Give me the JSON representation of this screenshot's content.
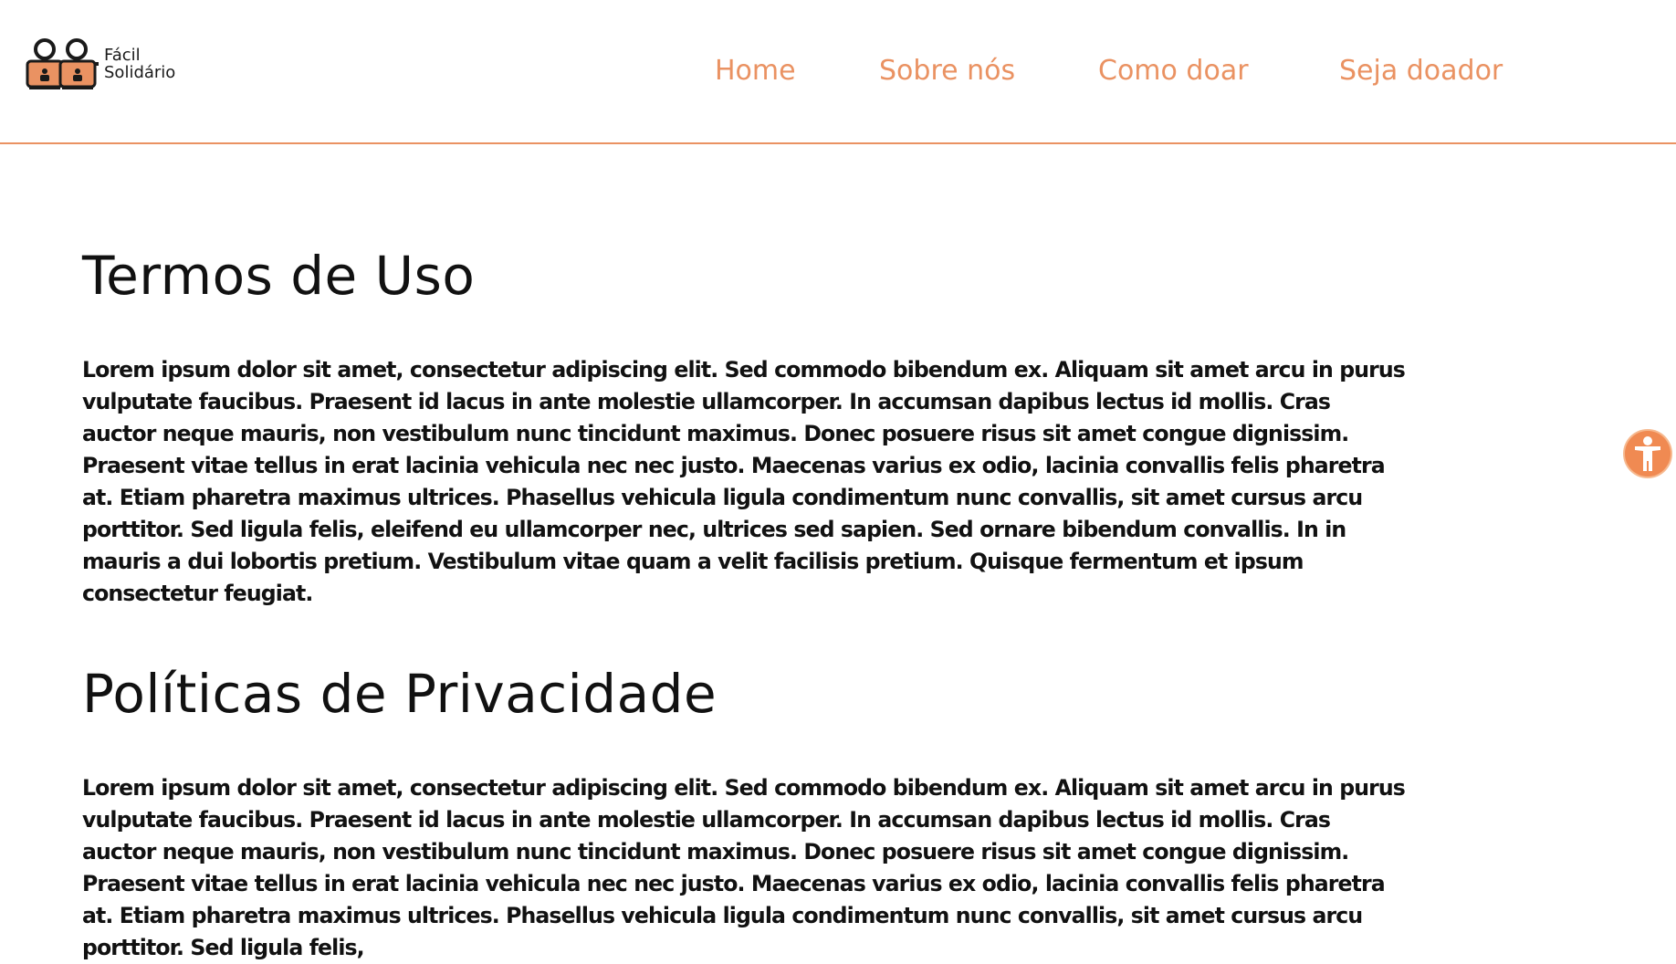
{
  "brand": {
    "line1": "Fácil",
    "line2": "Solidário",
    "logo_icon": "two-people-logo-icon",
    "accent_color": "#ea9262"
  },
  "nav": {
    "items": [
      {
        "label": "Home"
      },
      {
        "label": "Sobre nós"
      },
      {
        "label": "Como doar"
      },
      {
        "label": "Seja doador"
      }
    ]
  },
  "main": {
    "sections": [
      {
        "title": "Termos de Uso",
        "body": "Lorem ipsum dolor sit amet, consectetur adipiscing elit. Sed commodo bibendum ex. Aliquam sit amet arcu in purus vulputate faucibus. Praesent id lacus in ante molestie ullamcorper. In accumsan dapibus lectus id mollis. Cras auctor neque mauris, non vestibulum nunc tincidunt maximus. Donec posuere risus sit amet congue dignissim. Praesent vitae tellus in erat lacinia vehicula nec nec justo. Maecenas varius ex odio, lacinia convallis felis pharetra at. Etiam pharetra maximus ultrices. Phasellus vehicula ligula condimentum nunc convallis, sit amet cursus arcu porttitor. Sed ligula felis, eleifend eu ullamcorper nec, ultrices sed sapien. Sed ornare bibendum convallis. In in mauris a dui lobortis pretium. Vestibulum vitae quam a velit facilisis pretium. Quisque fermentum et ipsum consectetur feugiat."
      },
      {
        "title": "Políticas de Privacidade",
        "body": "Lorem ipsum dolor sit amet, consectetur adipiscing elit. Sed commodo bibendum ex. Aliquam sit amet arcu in purus vulputate faucibus. Praesent id lacus in ante molestie ullamcorper. In accumsan dapibus lectus id mollis. Cras auctor neque mauris, non vestibulum nunc tincidunt maximus. Donec posuere risus sit amet congue dignissim. Praesent vitae tellus in erat lacinia vehicula nec nec justo. Maecenas varius ex odio, lacinia convallis felis pharetra at. Etiam pharetra maximus ultrices. Phasellus vehicula ligula condimentum nunc convallis, sit amet cursus arcu porttitor. Sed ligula felis,"
      }
    ]
  },
  "accessibility": {
    "icon": "accessibility-icon",
    "color": "#f08a52"
  }
}
